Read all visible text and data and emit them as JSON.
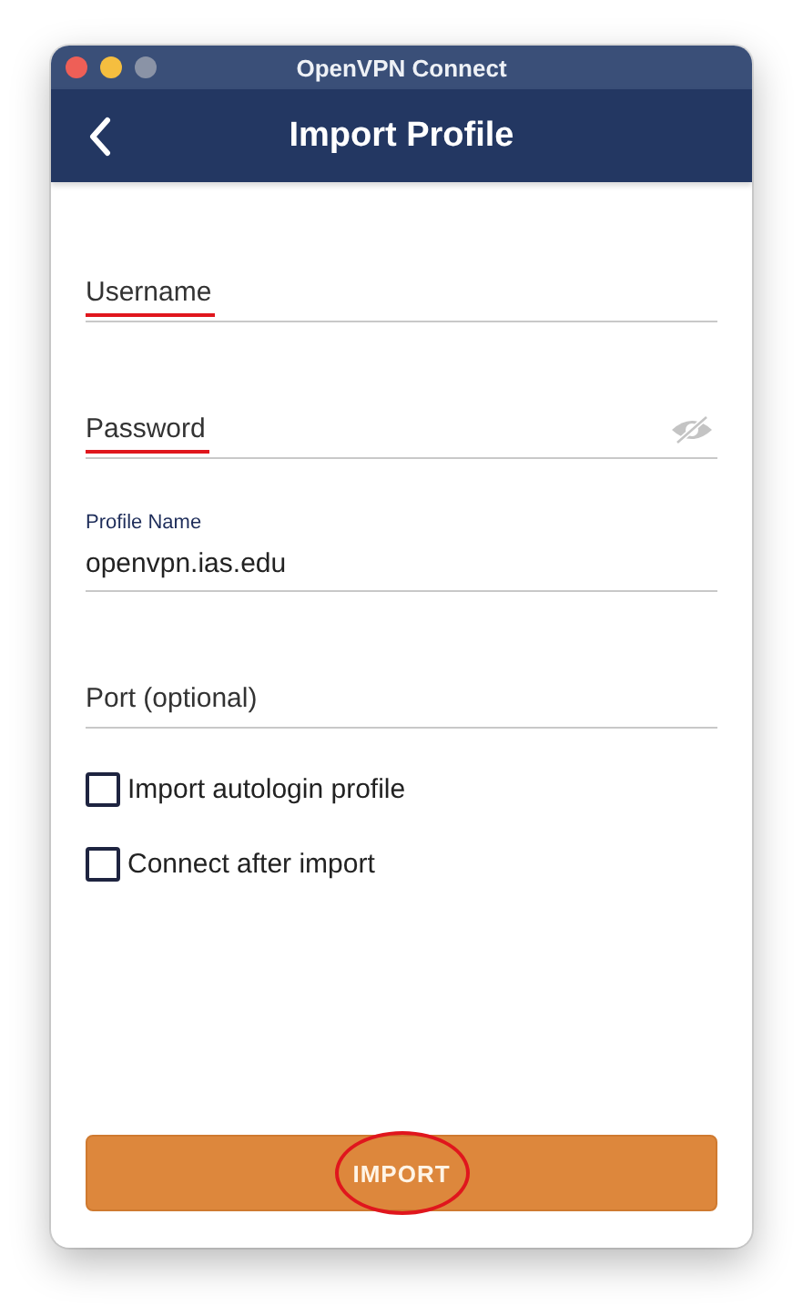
{
  "window": {
    "title": "OpenVPN Connect"
  },
  "header": {
    "title": "Import Profile"
  },
  "fields": [
    {
      "kind": "text",
      "placeholder": "Username",
      "marked": true
    },
    {
      "kind": "password",
      "placeholder": "Password",
      "marked": true
    },
    {
      "kind": "text",
      "label": "Profile Name",
      "value": "openvpn.ias.edu",
      "marked": false
    },
    {
      "kind": "text",
      "placeholder": "Port (optional)",
      "marked": false
    }
  ],
  "checkboxes": [
    {
      "label": "Import autologin profile",
      "checked": false
    },
    {
      "label": "Connect after import",
      "checked": false
    }
  ],
  "button": {
    "label": "IMPORT",
    "circled": true
  }
}
